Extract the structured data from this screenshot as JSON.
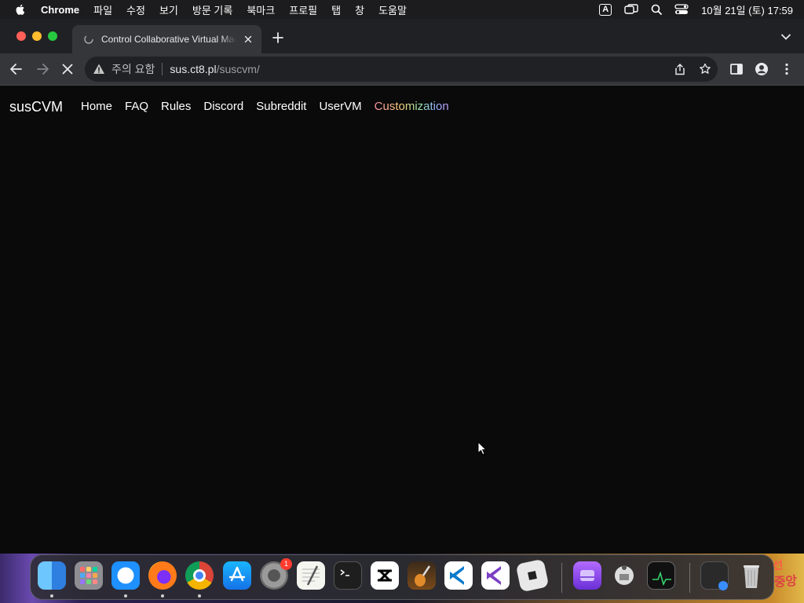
{
  "menubar": {
    "app_name": "Chrome",
    "menus": [
      "파일",
      "수정",
      "보기",
      "방문 기록",
      "북마크",
      "프로필",
      "탭",
      "창",
      "도움말"
    ],
    "input_source": "A",
    "datetime": "10월 21일 (토) 17:59"
  },
  "tab": {
    "title": "Control Collaborative Virtual Machines"
  },
  "omnibox": {
    "security_label": "주의 요함",
    "host": "sus.ct8.pl",
    "path": "/suscvm/"
  },
  "site": {
    "brand": "susCVM",
    "nav": [
      "Home",
      "FAQ",
      "Rules",
      "Discord",
      "Subreddit",
      "UserVM",
      "Customization"
    ]
  },
  "dock": {
    "apps": [
      "finder",
      "launchpad",
      "safari",
      "firefox",
      "chrome",
      "app-store",
      "system-settings",
      "textedit",
      "terminal",
      "capcut",
      "garageband",
      "vscode",
      "visual-studio",
      "roblox",
      "disk-utility",
      "automator",
      "activity-monitor",
      "screenshot",
      "trash"
    ],
    "system_settings_badge": "1"
  },
  "colors": {
    "accent_traffic_red": "#ff5f57",
    "accent_traffic_yellow": "#febc2e",
    "accent_traffic_green": "#28c840"
  }
}
